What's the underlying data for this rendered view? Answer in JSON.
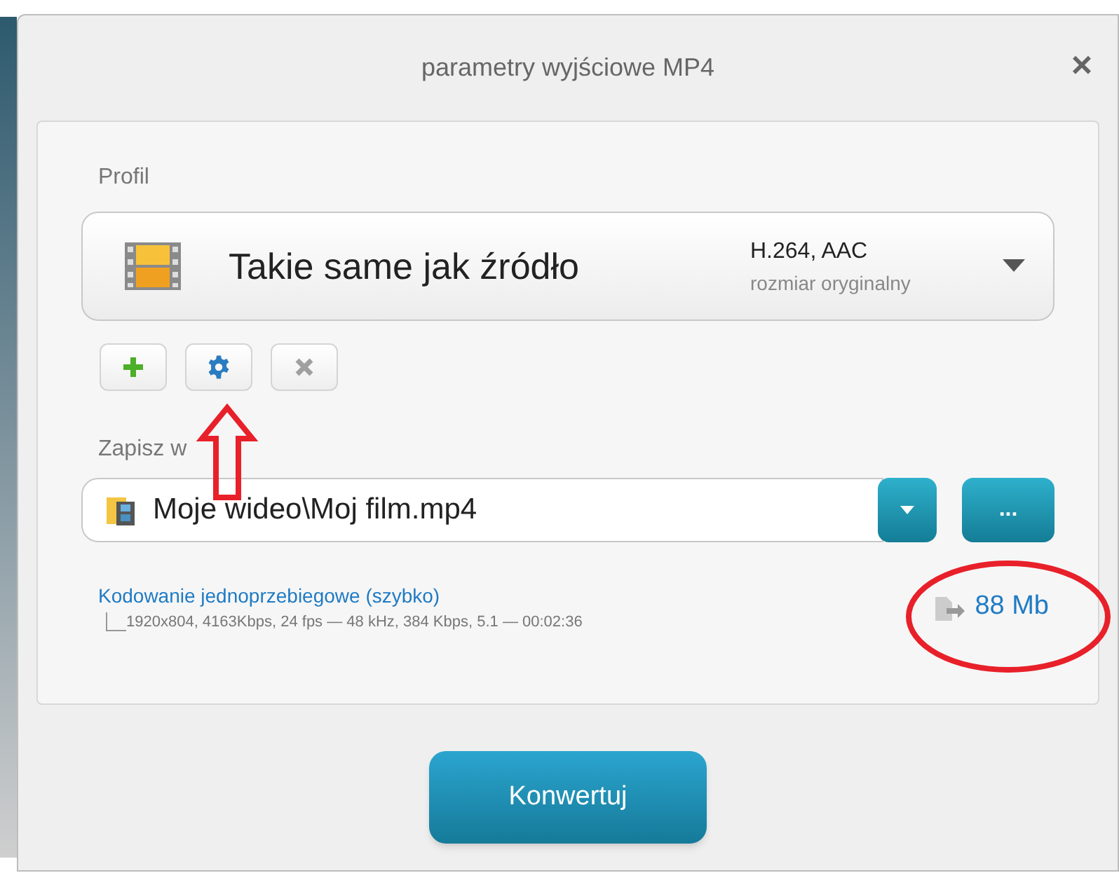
{
  "window": {
    "title": "parametry wyjściowe MP4",
    "close": "×"
  },
  "profile": {
    "label": "Profil",
    "name": "Takie same jak źródło",
    "codecs": "H.264, AAC",
    "size": "rozmiar oryginalny"
  },
  "profile_buttons": [
    {
      "kind": "add"
    },
    {
      "kind": "settings"
    },
    {
      "kind": "delete"
    }
  ],
  "save": {
    "label": "Zapisz w",
    "path": "Moje wideo\\Moj film.mp4",
    "browse": "..."
  },
  "encoding": {
    "mode": "Kodowanie jednoprzebiegowe (szybko)",
    "details": "1920x804, 4163Kbps, 24 fps — 48 kHz, 384 Kbps, 5.1 — 00:02:36",
    "file_size": "88 Mb"
  },
  "convert_button": "Konwertuj"
}
